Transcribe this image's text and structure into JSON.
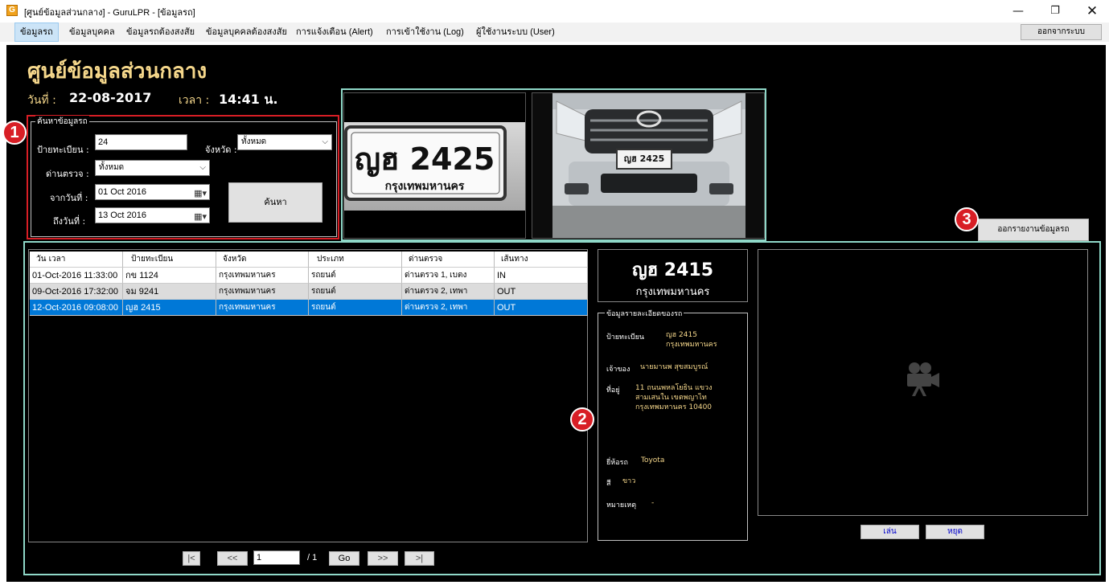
{
  "window": {
    "title": "[ศูนย์ข้อมูลส่วนกลาง] - GuruLPR - [ข้อมูลรถ]",
    "icon": "app-icon",
    "controls": [
      "—",
      "❐",
      "✕"
    ]
  },
  "menu": {
    "items": [
      {
        "label": "ข้อมูลรถ",
        "active": true
      },
      {
        "label": "ข้อมูลบุคคล"
      },
      {
        "label": "ข้อมูลรถต้องสงสัย"
      },
      {
        "label": "ข้อมูลบุคคลต้องสงสัย"
      },
      {
        "label": "การแจ้งเตือน (Alert)"
      },
      {
        "label": "การเข้าใช้งาน (Log)"
      },
      {
        "label": "ผู้ใช้งานระบบ (User)"
      }
    ],
    "logout": "ออกจากระบบ"
  },
  "header": {
    "title": "ศูนย์ข้อมูลส่วนกลาง",
    "date_label": "วันที่ :",
    "date_value": "22-08-2017",
    "time_label": "เวลา :",
    "time_value": "14:41 น."
  },
  "search": {
    "legend": "ค้นหาข้อมูลรถ",
    "plate_label": "ป้ายทะเบียน :",
    "plate_value": "24",
    "province_label": "จังหวัด :",
    "province_value": "ทั้งหมด",
    "checkpoint_label": "ด่านตรวจ :",
    "checkpoint_value": "ทั้งหมด",
    "from_label": "จากวันที่ :",
    "from_value": "01 Oct  2016",
    "to_label": "ถึงวันที่ :",
    "to_value": "13 Oct  2016",
    "button": "ค้นหา"
  },
  "badges": [
    "1",
    "2",
    "3"
  ],
  "images": {
    "plate_text": "ญฮ 2425",
    "plate_province": "กรุงเทพมหานคร"
  },
  "table": {
    "columns": [
      "วัน เวลา",
      "ป้ายทะเบียน",
      "จังหวัด",
      "ประเภท",
      "ด่านตรวจ",
      "เส้นทาง"
    ],
    "rows": [
      [
        "01-Oct-2016 11:33:00",
        "กข 1124",
        "กรุงเทพมหานคร",
        "รถยนต์",
        "ด่านตรวจ 1, เบตง",
        "IN"
      ],
      [
        "09-Oct-2016 17:32:00",
        "จม 9241",
        "กรุงเทพมหานคร",
        "รถยนต์",
        "ด่านตรวจ 2, เทพา",
        "OUT"
      ],
      [
        "12-Oct-2016 09:08:00",
        "ญฮ 2415",
        "กรุงเทพมหานคร",
        "รถยนต์",
        "ด่านตรวจ 2, เทพา",
        "OUT"
      ]
    ],
    "selected_row": 2
  },
  "pager": {
    "first": "|<",
    "prev": "<<",
    "page": "1",
    "total": "/ 1",
    "go": "Go",
    "next": ">>",
    "last": ">|"
  },
  "summary": {
    "plate": "ญฮ 2415",
    "province": "กรุงเทพมหานคร"
  },
  "detail": {
    "legend": "ข้อมูลรายละเอียดของรถ",
    "plate_label": "ป้ายทะเบียน",
    "plate_value": "ญฮ 2415\nกรุงเทพมหานคร",
    "owner_label": "เจ้าของ",
    "owner_value": "นายมานพ สุขสมบูรณ์",
    "address_label": "ที่อยู่",
    "address_value": "11 ถนนพหลโยธิน แขวง\nสามเสนใน เขตพญาไท\nกรุงเทพมหานคร 10400",
    "brand_label": "ยี่ห้อรถ",
    "brand_value": "Toyota",
    "color_label": "สี",
    "color_value": "ขาว",
    "note_label": "หมายเหตุ",
    "note_value": "-"
  },
  "video": {
    "icon": "video-camera-icon",
    "play": "เล่น",
    "stop": "หยุด"
  },
  "report_button": "ออกรายงานข้อมูลรถ",
  "colors": {
    "background": "#000000",
    "gold_text": "#f5d78b",
    "frame": "#8fd8c8",
    "badge": "#d81e25",
    "selection": "#0078d7"
  }
}
